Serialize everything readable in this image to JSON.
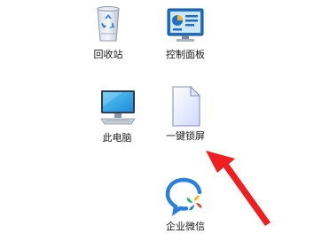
{
  "desktop": {
    "icons": [
      {
        "label": "回收站",
        "icon": "recycle-bin-icon"
      },
      {
        "label": "控制面板",
        "icon": "control-panel-icon"
      },
      {
        "label": "此电脑",
        "icon": "computer-icon"
      },
      {
        "label": "一键锁屏",
        "icon": "document-icon"
      },
      {
        "label": "企业微信",
        "icon": "wecom-icon"
      }
    ]
  },
  "annotation": {
    "arrow_color": "#f01e1e",
    "arrow_target": "一键锁屏"
  }
}
